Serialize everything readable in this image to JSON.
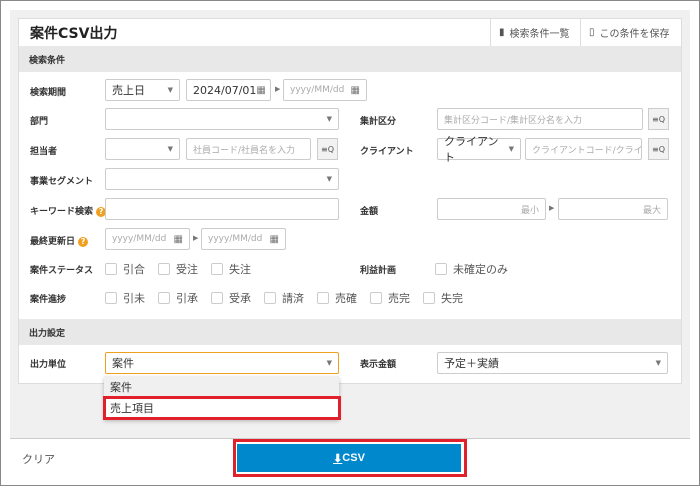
{
  "title": "案件CSV出力",
  "header": {
    "list_label": "検索条件一覧",
    "save_label": "この条件を保存"
  },
  "sections": {
    "search": "検索条件",
    "output": "出力設定"
  },
  "fields": {
    "period": {
      "label": "検索期間",
      "type_value": "売上日",
      "from": "2024/07/01",
      "to_placeholder": "yyyy/MM/dd"
    },
    "dept": {
      "label": "部門"
    },
    "agg": {
      "label": "集計区分",
      "placeholder": "集計区分コード/集計区分名を入力"
    },
    "person": {
      "label": "担当者",
      "placeholder": "社員コード/社員名を入力"
    },
    "client": {
      "label": "クライアント",
      "type_value": "クライアント",
      "placeholder": "クライアントコード/クライ"
    },
    "segment": {
      "label": "事業セグメント"
    },
    "keyword": {
      "label": "キーワード検索"
    },
    "amount": {
      "label": "金額",
      "min": "最小",
      "max": "最大"
    },
    "updated": {
      "label": "最終更新日",
      "from_placeholder": "yyyy/MM/dd",
      "to_placeholder": "yyyy/MM/dd"
    },
    "status": {
      "label": "案件ステータス",
      "options": [
        "引合",
        "受注",
        "失注"
      ]
    },
    "profit": {
      "label": "利益計画",
      "option": "未確定のみ"
    },
    "progress": {
      "label": "案件進捗",
      "options": [
        "引未",
        "引承",
        "受承",
        "請済",
        "売確",
        "売完",
        "失完"
      ]
    },
    "unit": {
      "label": "出力単位",
      "value": "案件",
      "options": [
        "案件",
        "売上項目"
      ]
    },
    "display": {
      "label": "表示金額",
      "value": "予定＋実績"
    }
  },
  "footer": {
    "clear": "クリア",
    "csv": "CSV"
  }
}
